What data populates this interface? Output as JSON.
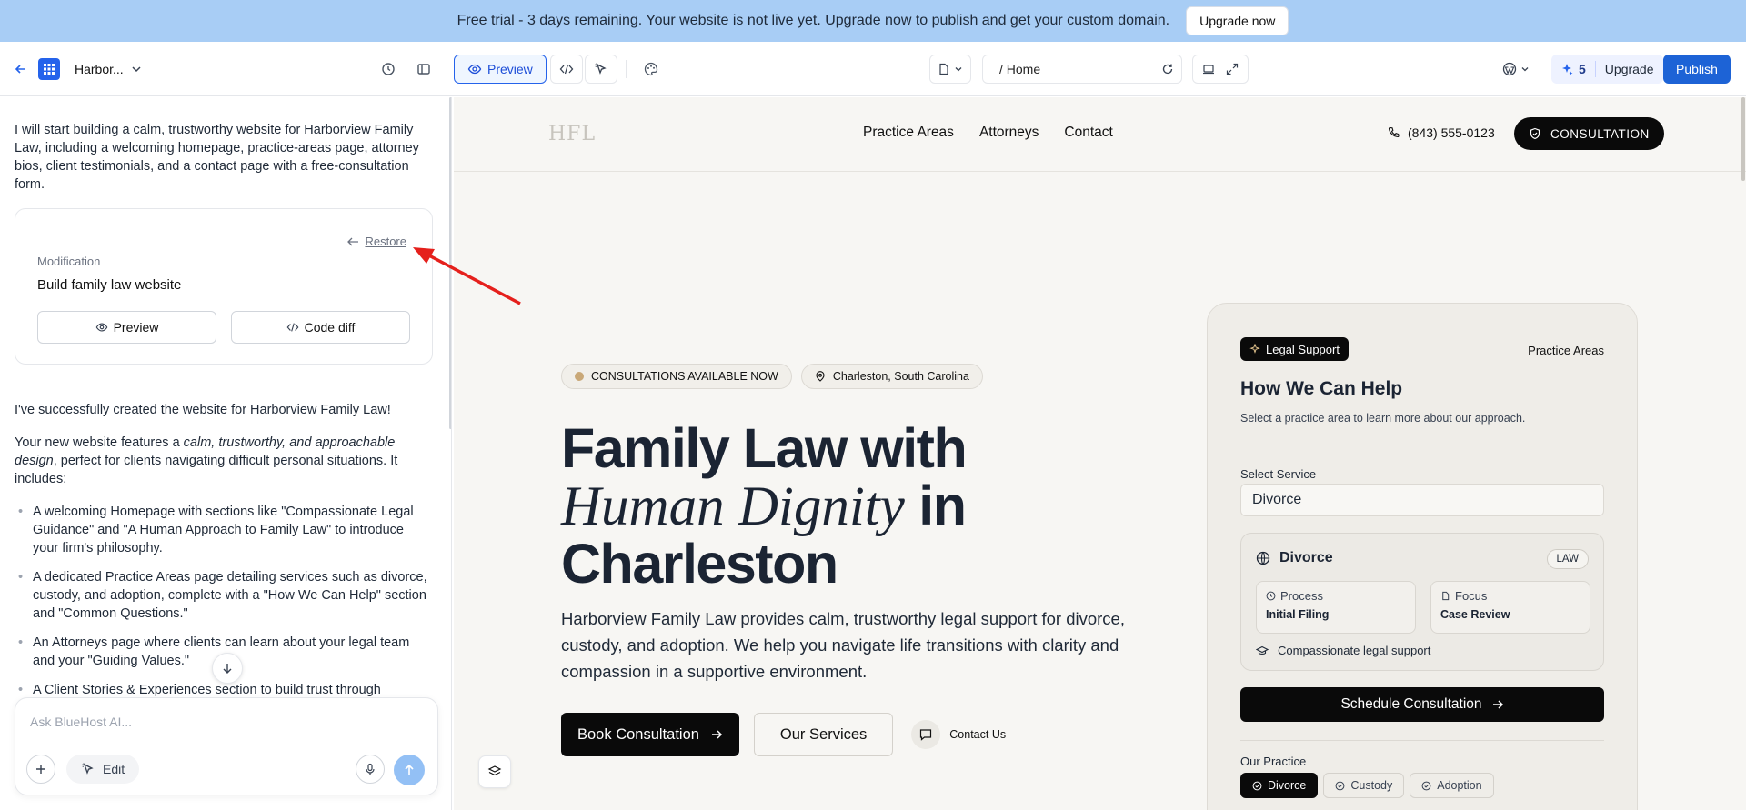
{
  "banner": {
    "message": "Free trial - 3 days remaining. Your website is not live yet. Upgrade now to publish and get your custom domain.",
    "upgrade_label": "Upgrade now"
  },
  "toolbar": {
    "site_name": "Harbor...",
    "preview_label": "Preview",
    "url_path": "/ Home",
    "credits": "5",
    "upgrade_label": "Upgrade",
    "publish_label": "Publish"
  },
  "chat": {
    "intro": "I will start building a calm, trustworthy website for Harborview Family Law, including a welcoming homepage, practice-areas page, attorney bios, client testimonials, and a contact page with a free-consultation form.",
    "card": {
      "restore_label": "Restore",
      "label": "Modification",
      "title": "Build family law website",
      "preview_label": "Preview",
      "diff_label": "Code diff"
    },
    "success": "I've successfully created the website for Harborview Family Law!",
    "features_intro_a": "Your new website features a ",
    "features_intro_em": "calm, trustworthy, and approachable design",
    "features_intro_b": ", perfect for clients navigating difficult personal situations. It includes:",
    "bullets": [
      "A welcoming Homepage with sections like \"Compassionate Legal Guidance\" and \"A Human Approach to Family Law\" to introduce your firm's philosophy.",
      "A dedicated Practice Areas page detailing services such as divorce, custody, and adoption, complete with a \"How We Can Help\" section and \"Common Questions.\"",
      "An Attorneys page where clients can learn about your legal team and your \"Guiding Values.\"",
      "A Client Stories & Experiences section to build trust through"
    ],
    "input_placeholder": "Ask BlueHost AI...",
    "edit_label": "Edit"
  },
  "site": {
    "brand": "HFL",
    "nav": [
      "Practice Areas",
      "Attorneys",
      "Contact"
    ],
    "phone": "(843) 555-0123",
    "consult_label": "CONSULTATION",
    "tag_available": "CONSULTATIONS AVAILABLE NOW",
    "tag_location": "Charleston, South Carolina",
    "title_line1": "Family Law with",
    "title_italic": "Human Dignity",
    "title_in": " in",
    "title_line3": "Charleston",
    "description": "Harborview Family Law provides calm, trustworthy legal support for divorce, custody, and adoption. We help you navigate life transitions with clarity and compassion in a supportive environment.",
    "book_label": "Book Consultation",
    "services_label": "Our Services",
    "contact_label": "Contact Us",
    "card": {
      "pill": "Legal Support",
      "practice_link": "Practice Areas",
      "title": "How We Can Help",
      "subtitle": "Select a practice area to learn more about our approach.",
      "select_label": "Select Service",
      "select_value": "Divorce",
      "service_name": "Divorce",
      "badge": "LAW",
      "process_label": "Process",
      "process_value": "Initial Filing",
      "focus_label": "Focus",
      "focus_value": "Case Review",
      "footnote": "Compassionate legal support",
      "schedule_label": "Schedule Consultation",
      "practice_label": "Our Practice",
      "chips": [
        "Divorce",
        "Custody",
        "Adoption"
      ]
    }
  },
  "colors": {
    "banner": "#a8cdf5",
    "accent": "#1d63d6",
    "annotation_arrow": "#e5201c"
  }
}
